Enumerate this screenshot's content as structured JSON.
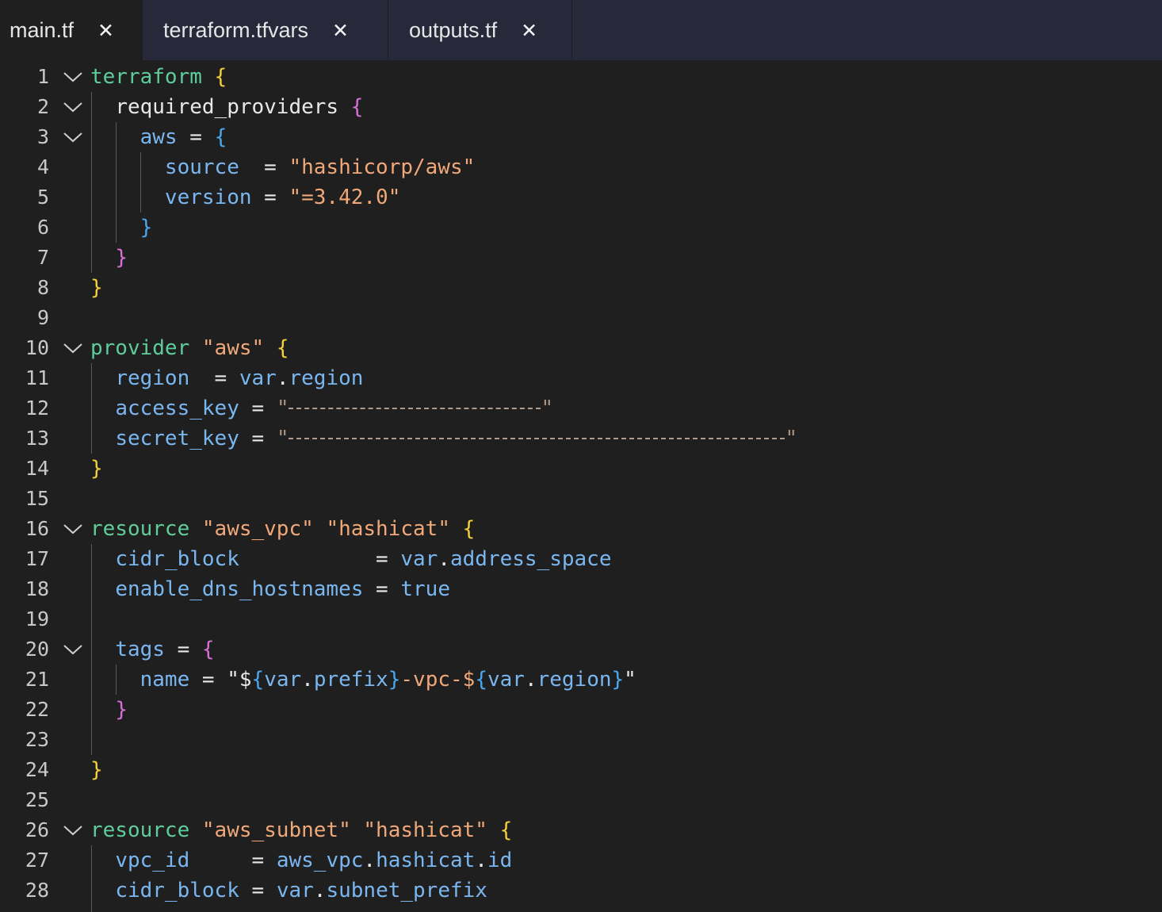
{
  "tabs": [
    {
      "label": "main.tf",
      "close": "✕",
      "active": true
    },
    {
      "label": "terraform.tfvars",
      "close": "✕",
      "active": false
    },
    {
      "label": "outputs.tf",
      "close": "✕",
      "active": false
    }
  ],
  "editor": {
    "line_numbers": [
      "1",
      "2",
      "3",
      "4",
      "5",
      "6",
      "7",
      "8",
      "9",
      "10",
      "11",
      "12",
      "13",
      "14",
      "15",
      "16",
      "17",
      "18",
      "19",
      "20",
      "21",
      "22",
      "23",
      "24",
      "25",
      "26",
      "27",
      "28"
    ],
    "code": {
      "l1": {
        "kw": "terraform",
        "br": "{"
      },
      "l2": {
        "attr": "required_providers",
        "br": "{"
      },
      "l3": {
        "attr": "aws",
        "op": "=",
        "br": "{"
      },
      "l4": {
        "attr": "source",
        "op": "=",
        "str": "\"hashicorp/aws\""
      },
      "l5": {
        "attr": "version",
        "op": "=",
        "str": "\"=3.42.0\""
      },
      "l6": {
        "br": "}"
      },
      "l7": {
        "br": "}"
      },
      "l8": {
        "br": "}"
      },
      "l10": {
        "kw": "provider",
        "str": "\"aws\"",
        "br": "{"
      },
      "l11": {
        "attr": "region",
        "op": "=",
        "val1": "var",
        "dot": ".",
        "val2": "region"
      },
      "l12": {
        "attr": "access_key",
        "op": "=",
        "redacted": "\""
      },
      "l13": {
        "attr": "secret_key",
        "op": "=",
        "redacted": "\""
      },
      "l14": {
        "br": "}"
      },
      "l16": {
        "kw": "resource",
        "str1": "\"aws_vpc\"",
        "str2": "\"hashicat\"",
        "br": "{"
      },
      "l17": {
        "attr": "cidr_block",
        "op": "=",
        "val1": "var",
        "dot": ".",
        "val2": "address_space"
      },
      "l18": {
        "attr": "enable_dns_hostnames",
        "op": "=",
        "val": "true"
      },
      "l20": {
        "attr": "tags",
        "op": "=",
        "br": "{"
      },
      "l21": {
        "attr": "name",
        "op": "=",
        "q1": "\"$",
        "b1": "{",
        "v1": "var",
        "d1": ".",
        "v2": "prefix",
        "b2": "}",
        "mid": "-vpc-$",
        "b3": "{",
        "v3": "var",
        "d2": ".",
        "v4": "region",
        "b4": "}",
        "q2": "\""
      },
      "l22": {
        "br": "}"
      },
      "l24": {
        "br": "}"
      },
      "l26": {
        "kw": "resource",
        "str1": "\"aws_subnet\"",
        "str2": "\"hashicat\"",
        "br": "{"
      },
      "l27": {
        "attr": "vpc_id",
        "op": "=",
        "v1": "aws_vpc",
        "d1": ".",
        "v2": "hashicat",
        "d2": ".",
        "v3": "id"
      },
      "l28": {
        "attr": "cidr_block",
        "op": "=",
        "v1": "var",
        "d1": ".",
        "v2": "subnet_prefix"
      }
    }
  },
  "colors": {
    "keyword": "#5fcc9c",
    "attribute": "#7ab6ef",
    "string": "#f0a878",
    "bracket_level1": "#f5d03c",
    "bracket_level2": "#d870d8",
    "bracket_level3": "#4aa8f0",
    "background": "#1f1f1f",
    "tabbar": "#27293a"
  }
}
